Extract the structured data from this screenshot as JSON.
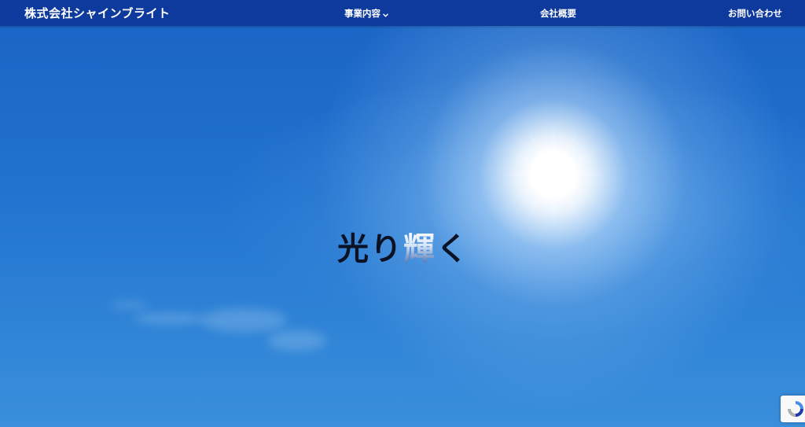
{
  "header": {
    "brand": "株式会社シャインブライト",
    "nav": {
      "services": "事業内容",
      "about": "会社概要",
      "contact": "お問い合わせ"
    }
  },
  "hero": {
    "title_part1": "光り",
    "title_part2": "輝",
    "title_part3": "く"
  },
  "icons": {
    "services_dropdown": "chevron-down-icon",
    "recaptcha": "recaptcha-icon"
  },
  "colors": {
    "header_bg": "#0d3a9c",
    "sky": "#1f6cc9",
    "title_text": "#0b1224"
  }
}
